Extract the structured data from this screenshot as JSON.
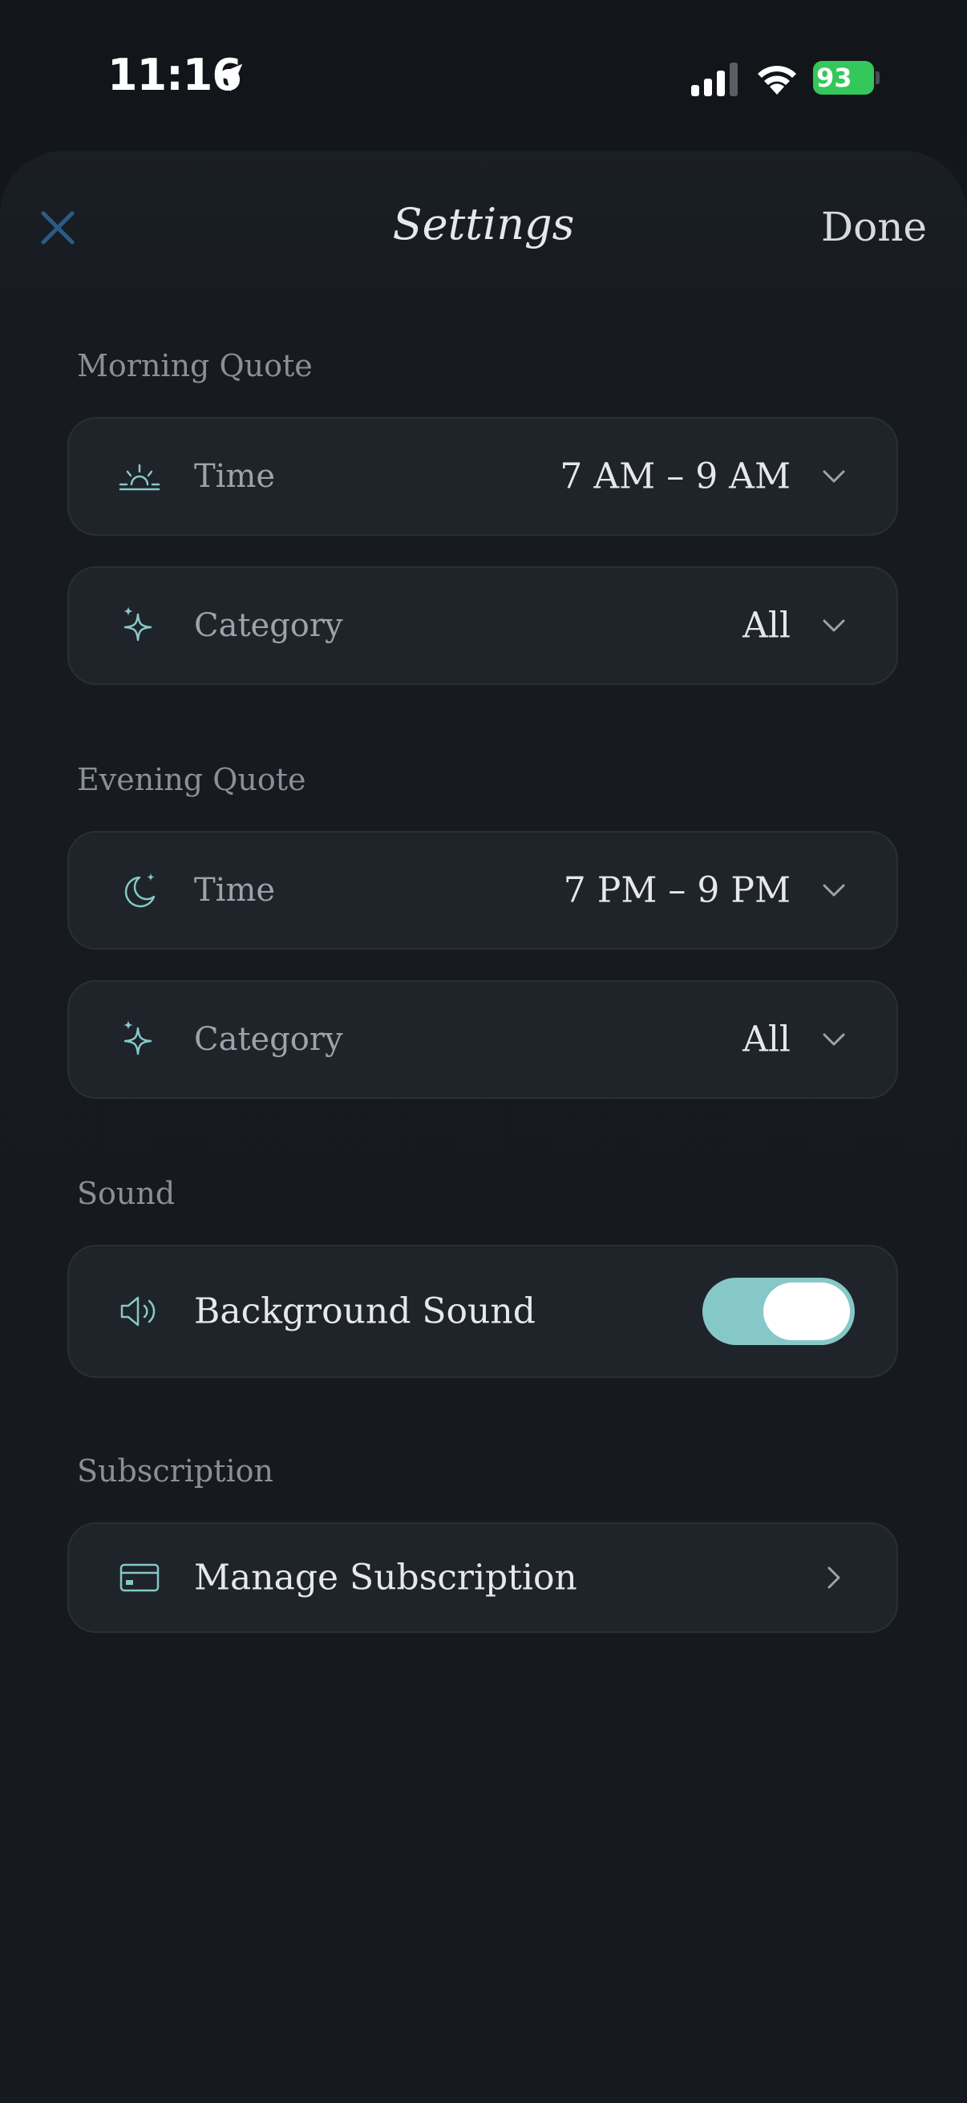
{
  "status_bar": {
    "time": "11:16",
    "battery": "93",
    "icons": [
      "location-arrow-icon",
      "cellular-signal-icon",
      "wifi-icon",
      "battery-charging-icon"
    ]
  },
  "header": {
    "close_icon": "close-icon",
    "title": "Settings",
    "done_label": "Done"
  },
  "sections": {
    "morning": {
      "title": "Morning Quote",
      "time_label": "Time",
      "time_value": "7 AM – 9 AM",
      "category_label": "Category",
      "category_value": "All"
    },
    "evening": {
      "title": "Evening Quote",
      "time_label": "Time",
      "time_value": "7 PM – 9 PM",
      "category_label": "Category",
      "category_value": "All"
    },
    "sound": {
      "title": "Sound",
      "background_label": "Background Sound",
      "background_enabled": true
    },
    "subscription": {
      "title": "Subscription",
      "manage_label": "Manage Subscription"
    }
  },
  "colors": {
    "accent": "#86c8c8",
    "background": "#14171d",
    "card": "#1f232a",
    "battery": "#34c759",
    "close": "#2d5b86"
  }
}
